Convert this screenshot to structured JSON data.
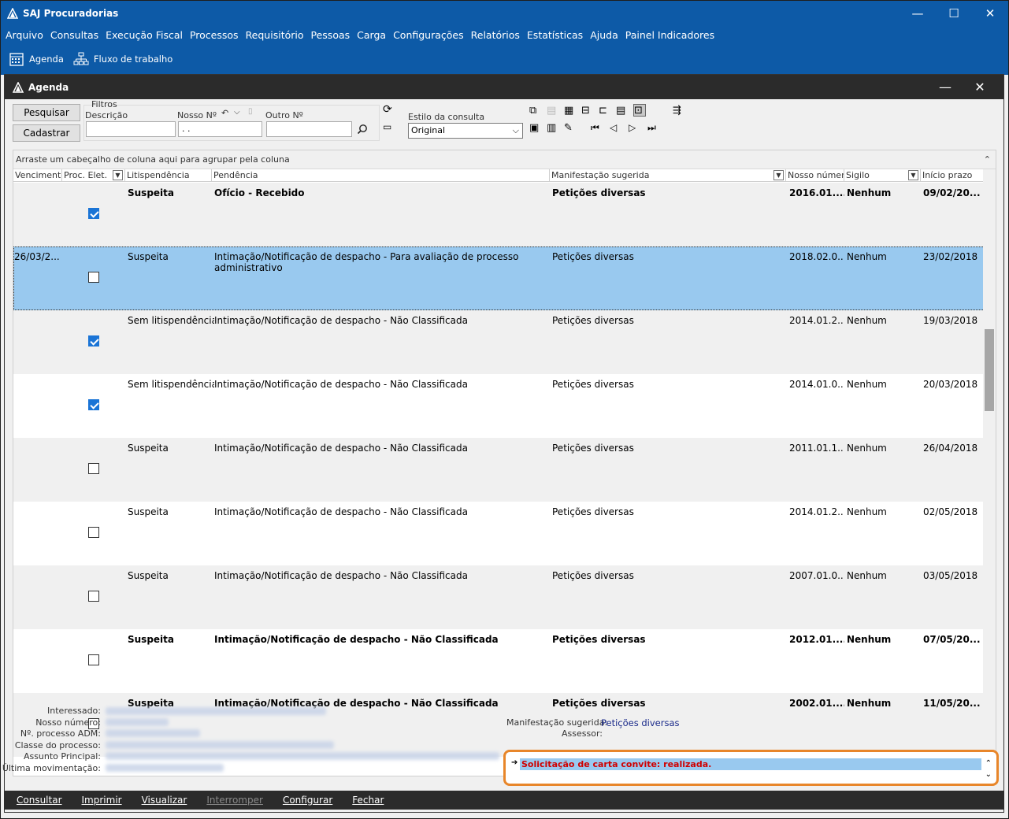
{
  "app": {
    "title": "SAJ Procuradorias"
  },
  "menu": [
    "Arquivo",
    "Consultas",
    "Execução Fiscal",
    "Processos",
    "Requisitório",
    "Pessoas",
    "Carga",
    "Configurações",
    "Relatórios",
    "Estatísticas",
    "Ajuda",
    "Painel Indicadores"
  ],
  "toolbar": {
    "agenda": "Agenda",
    "fluxo": "Fluxo de trabalho"
  },
  "window": {
    "title": "Agenda"
  },
  "filters": {
    "pesquisar": "Pesquisar",
    "cadastrar": "Cadastrar",
    "filtros": "Filtros",
    "descricao": "Descrição",
    "nosso_no": "Nosso Nº",
    "nosso_no_value": ". .",
    "outro_no": "Outro Nº",
    "estilo": "Estilo da consulta",
    "estilo_value": "Original"
  },
  "grid": {
    "group_hint": "Arraste um cabeçalho de coluna aqui para agrupar pela coluna",
    "columns": [
      "Vencimento",
      "Proc. Elet.",
      "Litispendência",
      "Pendência",
      "Manifestação sugerida",
      "Nosso número",
      "Sigilo",
      "Início prazo"
    ],
    "rows": [
      {
        "venc": "",
        "proc": true,
        "lit": "Suspeita",
        "pend": "Ofício - Recebido",
        "manif": "Petições diversas",
        "nosso": "2016.01....",
        "sigilo": "Nenhum",
        "inicio": "09/02/20...",
        "bold": true
      },
      {
        "venc": "26/03/2...",
        "proc": false,
        "lit": "Suspeita",
        "pend": "Intimação/Notificação de despacho - Para avaliação de processo administrativo",
        "manif": "Petições diversas",
        "nosso": "2018.02.0...",
        "sigilo": "Nenhum",
        "inicio": "23/02/2018",
        "bold": false,
        "selected": true
      },
      {
        "venc": "",
        "proc": true,
        "lit": "Sem litispendência",
        "pend": "Intimação/Notificação de despacho - Não Classificada",
        "manif": "Petições diversas",
        "nosso": "2014.01.2...",
        "sigilo": "Nenhum",
        "inicio": "19/03/2018",
        "bold": false
      },
      {
        "venc": "",
        "proc": true,
        "lit": "Sem litispendência",
        "pend": "Intimação/Notificação de despacho - Não Classificada",
        "manif": "Petições diversas",
        "nosso": "2014.01.0...",
        "sigilo": "Nenhum",
        "inicio": "20/03/2018",
        "bold": false
      },
      {
        "venc": "",
        "proc": false,
        "lit": "Suspeita",
        "pend": "Intimação/Notificação de despacho - Não Classificada",
        "manif": "Petições diversas",
        "nosso": "2011.01.1...",
        "sigilo": "Nenhum",
        "inicio": "26/04/2018",
        "bold": false
      },
      {
        "venc": "",
        "proc": false,
        "lit": "Suspeita",
        "pend": "Intimação/Notificação de despacho - Não Classificada",
        "manif": "Petições diversas",
        "nosso": "2014.01.2...",
        "sigilo": "Nenhum",
        "inicio": "02/05/2018",
        "bold": false
      },
      {
        "venc": "",
        "proc": false,
        "lit": "Suspeita",
        "pend": "Intimação/Notificação de despacho - Não Classificada",
        "manif": "Petições diversas",
        "nosso": "2007.01.0...",
        "sigilo": "Nenhum",
        "inicio": "03/05/2018",
        "bold": false
      },
      {
        "venc": "",
        "proc": false,
        "lit": "Suspeita",
        "pend": "Intimação/Notificação de despacho - Não Classificada",
        "manif": "Petições diversas",
        "nosso": "2012.01....",
        "sigilo": "Nenhum",
        "inicio": "07/05/20...",
        "bold": true
      },
      {
        "venc": "",
        "proc": false,
        "lit": "Suspeita",
        "pend": "Intimação/Notificação de despacho - Não Classificada",
        "manif": "Petições diversas",
        "nosso": "2002.01....",
        "sigilo": "Nenhum",
        "inicio": "11/05/20...",
        "bold": true
      }
    ]
  },
  "details": {
    "labels": [
      "Interessado:",
      "Nosso número:",
      "Nº. processo ADM:",
      "Classe do processo:",
      "Assunto Principal:",
      "Última movimentação:"
    ],
    "manif_label": "Manifestação sugerida:",
    "manif_value": "Petições diversas",
    "assessor_label": "Assessor:",
    "note": "Solicitação de carta convite: realizada."
  },
  "bottom": [
    "Consultar",
    "Imprimir",
    "Visualizar",
    "Interromper",
    "Configurar",
    "Fechar"
  ]
}
